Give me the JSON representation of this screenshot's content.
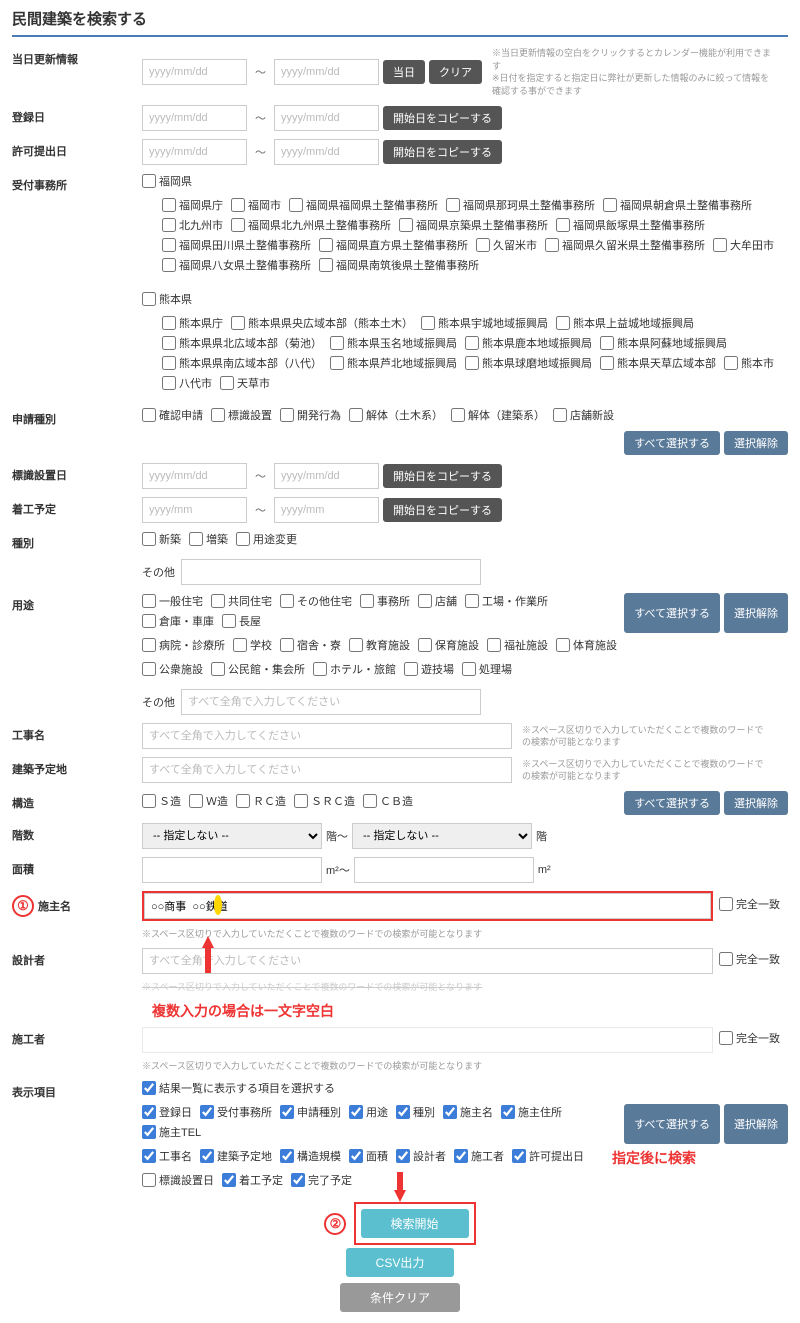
{
  "title": "民間建築を検索する",
  "labels": {
    "update_date": "当日更新情報",
    "reg_date": "登録日",
    "permit_date": "許可提出日",
    "office": "受付事務所",
    "app_type": "申請種別",
    "sign_date": "標識設置日",
    "start_date": "着工予定",
    "kind": "種別",
    "use": "用途",
    "work_name": "工事名",
    "build_loc": "建築予定地",
    "structure": "構造",
    "floors": "階数",
    "area": "面積",
    "owner": "施主名",
    "designer": "設計者",
    "contractor": "施工者",
    "display": "表示項目"
  },
  "placeholders": {
    "date": "yyyy/mm/dd",
    "ym": "yyyy/mm",
    "text_full": "すべて全角で入力してください"
  },
  "sep": "～",
  "buttons": {
    "today": "当日",
    "clear": "クリア",
    "copy_start": "開始日をコピーする",
    "select_all": "すべて選択する",
    "deselect": "選択解除",
    "search": "検索開始",
    "csv": "CSV出力",
    "cond_clear": "条件クリア"
  },
  "notes": {
    "update": "※当日更新情報の空白をクリックするとカレンダー機能が利用できます\n※日付を指定すると指定日に弊社が更新した情報のみに絞って情報を確認する事ができます",
    "space": "※スペース区切りで入力していただくことで複数のワードでの検索が可能となります",
    "space2": "※スペース区切りで入力していただくことで複数のワードでの検索が可能となります"
  },
  "other": "その他",
  "office_groups": {
    "fukuoka": {
      "parent": "福岡県",
      "items": [
        "福岡県庁",
        "福岡市",
        "福岡県福岡県土整備事務所",
        "福岡県那珂県土整備事務所",
        "福岡県朝倉県土整備事務所",
        "北九州市",
        "福岡県北九州県土整備事務所",
        "福岡県京築県土整備事務所",
        "福岡県飯塚県土整備事務所",
        "福岡県田川県土整備事務所",
        "福岡県直方県土整備事務所",
        "久留米市",
        "福岡県久留米県土整備事務所",
        "大牟田市",
        "福岡県八女県土整備事務所",
        "福岡県南筑後県土整備事務所"
      ]
    },
    "kumamoto": {
      "parent": "熊本県",
      "items": [
        "熊本県庁",
        "熊本県県央広域本部（熊本土木）",
        "熊本県宇城地域振興局",
        "熊本県上益城地域振興局",
        "熊本県県北広域本部（菊池）",
        "熊本県玉名地域振興局",
        "熊本県鹿本地域振興局",
        "熊本県阿蘇地域振興局",
        "熊本県県南広域本部（八代）",
        "熊本県芦北地域振興局",
        "熊本県球磨地域振興局",
        "熊本県天草広域本部",
        "熊本市",
        "八代市",
        "天草市"
      ]
    }
  },
  "app_types": [
    "確認申請",
    "標識設置",
    "開発行為",
    "解体（土木系）",
    "解体（建築系）",
    "店舗新設"
  ],
  "kinds": [
    "新築",
    "増築",
    "用途変更"
  ],
  "uses_row1": [
    "一般住宅",
    "共同住宅",
    "その他住宅",
    "事務所",
    "店舗",
    "工場・作業所",
    "倉庫・車庫",
    "長屋"
  ],
  "uses_row2": [
    "病院・診療所",
    "学校",
    "宿舎・寮",
    "教育施設",
    "保育施設",
    "福祉施設",
    "体育施設"
  ],
  "uses_row3": [
    "公衆施設",
    "公民館・集会所",
    "ホテル・旅館",
    "遊技場",
    "処理場"
  ],
  "structures": [
    "Ｓ造",
    "Ｗ造",
    "ＲＣ造",
    "ＳＲＣ造",
    "ＣＢ造"
  ],
  "floor_select": "-- 指定しない --",
  "floor_unit": "階",
  "area_unit": "m²",
  "owner_value": "○○商事  ○○鉄道",
  "exact": "完全一致",
  "display_header": "結果一覧に表示する項目を選択する",
  "display_items_row1": [
    "登録日",
    "受付事務所",
    "申請種別",
    "用途",
    "種別",
    "施主名",
    "施主住所",
    "施主TEL"
  ],
  "display_items_row2": [
    "工事名",
    "建築予定地",
    "構造規模",
    "面積",
    "設計者",
    "施工者",
    "許可提出日"
  ],
  "display_items_row3": [
    "標識設置日",
    "着工予定",
    "完了予定"
  ],
  "display_checked_row3": [
    false,
    true,
    true
  ],
  "anno1": "複数入力の場合は一文字空白",
  "anno2": "指定後に検索"
}
